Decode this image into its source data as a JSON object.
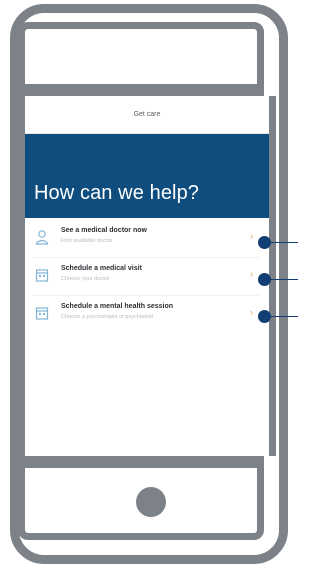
{
  "header": {
    "title": "Get care"
  },
  "hero": {
    "title": "How can we help?"
  },
  "items": [
    {
      "title": "See a medical doctor now",
      "subtitle": "First available doctor",
      "icon": "doctor-icon"
    },
    {
      "title": "Schedule a medical visit",
      "subtitle": "Choose your doctor",
      "icon": "calendar-icon"
    },
    {
      "title": "Schedule a mental health session",
      "subtitle": "Choose a psychologist or psychiatrist",
      "icon": "calendar-icon"
    }
  ],
  "colors": {
    "brand": "#0f4d7f",
    "frame": "#7c8287",
    "callout": "#123f73",
    "chevron": "#d9a15c"
  }
}
